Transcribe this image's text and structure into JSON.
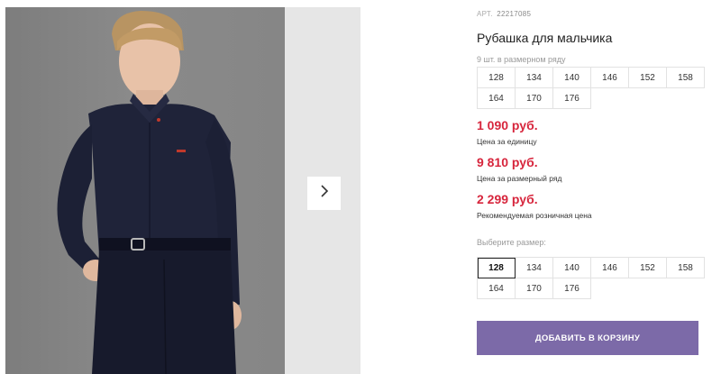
{
  "product": {
    "sku_label": "АРТ.",
    "sku": "22217085",
    "title": "Рубашка для мальчика",
    "pack_note": "9 шт. в размерном ряду",
    "pack_sizes": [
      "128",
      "134",
      "140",
      "146",
      "152",
      "158",
      "164",
      "170",
      "176"
    ],
    "prices": [
      {
        "value": "1 090 руб.",
        "label": "Цена за единицу"
      },
      {
        "value": "9 810 руб.",
        "label": "Цена за размерный ряд"
      },
      {
        "value": "2 299 руб.",
        "label": "Рекомендуемая розничная цена"
      }
    ],
    "choose_label": "Выберите размер:",
    "select_sizes": [
      "128",
      "134",
      "140",
      "146",
      "152",
      "158",
      "164",
      "170",
      "176"
    ],
    "selected_size": "128",
    "cart_label": "ДОБАВИТЬ В КОРЗИНУ"
  },
  "gallery": {
    "next_icon": "chevron-right-icon"
  },
  "colors": {
    "price": "#d7263d",
    "button": "#7c6aa8",
    "shirt": "#1e2238"
  }
}
